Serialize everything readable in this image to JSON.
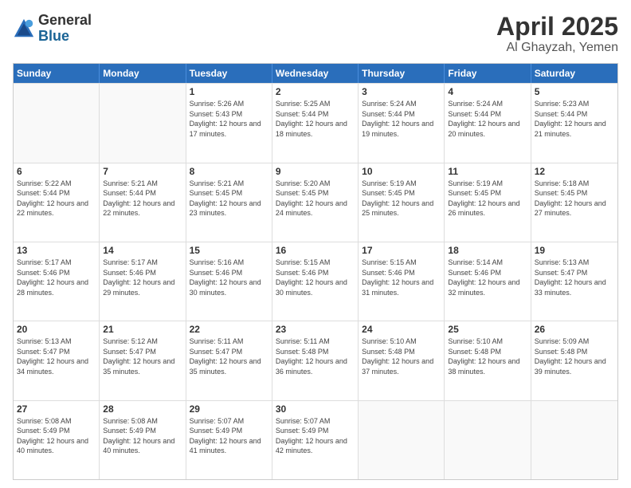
{
  "logo": {
    "general": "General",
    "blue": "Blue"
  },
  "title": "April 2025",
  "subtitle": "Al Ghayzah, Yemen",
  "days": [
    "Sunday",
    "Monday",
    "Tuesday",
    "Wednesday",
    "Thursday",
    "Friday",
    "Saturday"
  ],
  "weeks": [
    [
      {
        "date": "",
        "sunrise": "",
        "sunset": "",
        "daylight": ""
      },
      {
        "date": "",
        "sunrise": "",
        "sunset": "",
        "daylight": ""
      },
      {
        "date": "1",
        "sunrise": "Sunrise: 5:26 AM",
        "sunset": "Sunset: 5:43 PM",
        "daylight": "Daylight: 12 hours and 17 minutes."
      },
      {
        "date": "2",
        "sunrise": "Sunrise: 5:25 AM",
        "sunset": "Sunset: 5:44 PM",
        "daylight": "Daylight: 12 hours and 18 minutes."
      },
      {
        "date": "3",
        "sunrise": "Sunrise: 5:24 AM",
        "sunset": "Sunset: 5:44 PM",
        "daylight": "Daylight: 12 hours and 19 minutes."
      },
      {
        "date": "4",
        "sunrise": "Sunrise: 5:24 AM",
        "sunset": "Sunset: 5:44 PM",
        "daylight": "Daylight: 12 hours and 20 minutes."
      },
      {
        "date": "5",
        "sunrise": "Sunrise: 5:23 AM",
        "sunset": "Sunset: 5:44 PM",
        "daylight": "Daylight: 12 hours and 21 minutes."
      }
    ],
    [
      {
        "date": "6",
        "sunrise": "Sunrise: 5:22 AM",
        "sunset": "Sunset: 5:44 PM",
        "daylight": "Daylight: 12 hours and 22 minutes."
      },
      {
        "date": "7",
        "sunrise": "Sunrise: 5:21 AM",
        "sunset": "Sunset: 5:44 PM",
        "daylight": "Daylight: 12 hours and 22 minutes."
      },
      {
        "date": "8",
        "sunrise": "Sunrise: 5:21 AM",
        "sunset": "Sunset: 5:45 PM",
        "daylight": "Daylight: 12 hours and 23 minutes."
      },
      {
        "date": "9",
        "sunrise": "Sunrise: 5:20 AM",
        "sunset": "Sunset: 5:45 PM",
        "daylight": "Daylight: 12 hours and 24 minutes."
      },
      {
        "date": "10",
        "sunrise": "Sunrise: 5:19 AM",
        "sunset": "Sunset: 5:45 PM",
        "daylight": "Daylight: 12 hours and 25 minutes."
      },
      {
        "date": "11",
        "sunrise": "Sunrise: 5:19 AM",
        "sunset": "Sunset: 5:45 PM",
        "daylight": "Daylight: 12 hours and 26 minutes."
      },
      {
        "date": "12",
        "sunrise": "Sunrise: 5:18 AM",
        "sunset": "Sunset: 5:45 PM",
        "daylight": "Daylight: 12 hours and 27 minutes."
      }
    ],
    [
      {
        "date": "13",
        "sunrise": "Sunrise: 5:17 AM",
        "sunset": "Sunset: 5:46 PM",
        "daylight": "Daylight: 12 hours and 28 minutes."
      },
      {
        "date": "14",
        "sunrise": "Sunrise: 5:17 AM",
        "sunset": "Sunset: 5:46 PM",
        "daylight": "Daylight: 12 hours and 29 minutes."
      },
      {
        "date": "15",
        "sunrise": "Sunrise: 5:16 AM",
        "sunset": "Sunset: 5:46 PM",
        "daylight": "Daylight: 12 hours and 30 minutes."
      },
      {
        "date": "16",
        "sunrise": "Sunrise: 5:15 AM",
        "sunset": "Sunset: 5:46 PM",
        "daylight": "Daylight: 12 hours and 30 minutes."
      },
      {
        "date": "17",
        "sunrise": "Sunrise: 5:15 AM",
        "sunset": "Sunset: 5:46 PM",
        "daylight": "Daylight: 12 hours and 31 minutes."
      },
      {
        "date": "18",
        "sunrise": "Sunrise: 5:14 AM",
        "sunset": "Sunset: 5:46 PM",
        "daylight": "Daylight: 12 hours and 32 minutes."
      },
      {
        "date": "19",
        "sunrise": "Sunrise: 5:13 AM",
        "sunset": "Sunset: 5:47 PM",
        "daylight": "Daylight: 12 hours and 33 minutes."
      }
    ],
    [
      {
        "date": "20",
        "sunrise": "Sunrise: 5:13 AM",
        "sunset": "Sunset: 5:47 PM",
        "daylight": "Daylight: 12 hours and 34 minutes."
      },
      {
        "date": "21",
        "sunrise": "Sunrise: 5:12 AM",
        "sunset": "Sunset: 5:47 PM",
        "daylight": "Daylight: 12 hours and 35 minutes."
      },
      {
        "date": "22",
        "sunrise": "Sunrise: 5:11 AM",
        "sunset": "Sunset: 5:47 PM",
        "daylight": "Daylight: 12 hours and 35 minutes."
      },
      {
        "date": "23",
        "sunrise": "Sunrise: 5:11 AM",
        "sunset": "Sunset: 5:48 PM",
        "daylight": "Daylight: 12 hours and 36 minutes."
      },
      {
        "date": "24",
        "sunrise": "Sunrise: 5:10 AM",
        "sunset": "Sunset: 5:48 PM",
        "daylight": "Daylight: 12 hours and 37 minutes."
      },
      {
        "date": "25",
        "sunrise": "Sunrise: 5:10 AM",
        "sunset": "Sunset: 5:48 PM",
        "daylight": "Daylight: 12 hours and 38 minutes."
      },
      {
        "date": "26",
        "sunrise": "Sunrise: 5:09 AM",
        "sunset": "Sunset: 5:48 PM",
        "daylight": "Daylight: 12 hours and 39 minutes."
      }
    ],
    [
      {
        "date": "27",
        "sunrise": "Sunrise: 5:08 AM",
        "sunset": "Sunset: 5:49 PM",
        "daylight": "Daylight: 12 hours and 40 minutes."
      },
      {
        "date": "28",
        "sunrise": "Sunrise: 5:08 AM",
        "sunset": "Sunset: 5:49 PM",
        "daylight": "Daylight: 12 hours and 40 minutes."
      },
      {
        "date": "29",
        "sunrise": "Sunrise: 5:07 AM",
        "sunset": "Sunset: 5:49 PM",
        "daylight": "Daylight: 12 hours and 41 minutes."
      },
      {
        "date": "30",
        "sunrise": "Sunrise: 5:07 AM",
        "sunset": "Sunset: 5:49 PM",
        "daylight": "Daylight: 12 hours and 42 minutes."
      },
      {
        "date": "",
        "sunrise": "",
        "sunset": "",
        "daylight": ""
      },
      {
        "date": "",
        "sunrise": "",
        "sunset": "",
        "daylight": ""
      },
      {
        "date": "",
        "sunrise": "",
        "sunset": "",
        "daylight": ""
      }
    ]
  ]
}
